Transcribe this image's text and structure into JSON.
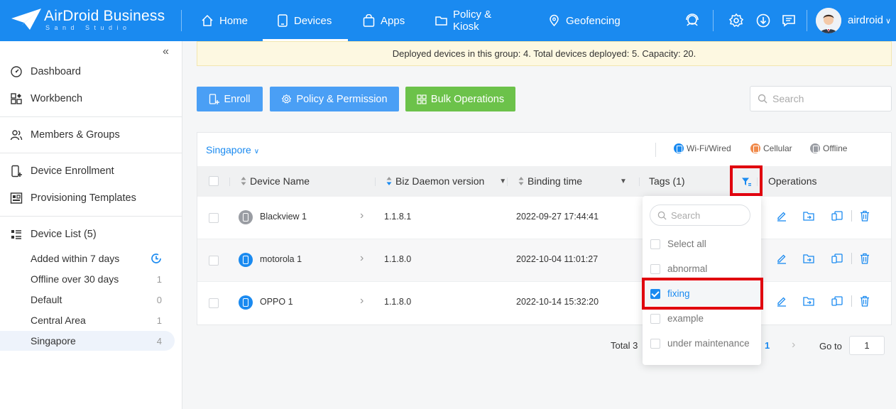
{
  "app": {
    "brand": "AirDroid Business",
    "sub_brand": "Sand Studio",
    "user": "airdroid",
    "nav": [
      {
        "label": "Home",
        "icon": "home-icon"
      },
      {
        "label": "Devices",
        "icon": "device-icon"
      },
      {
        "label": "Apps",
        "icon": "apps-bag-icon"
      },
      {
        "label": "Policy & Kiosk",
        "icon": "folder-icon"
      },
      {
        "label": "Geofencing",
        "icon": "map-pin-icon"
      }
    ],
    "active_nav": "Devices"
  },
  "sidebar": {
    "items": [
      {
        "label": "Dashboard",
        "icon": "dashboard-icon"
      },
      {
        "label": "Workbench",
        "icon": "workbench-icon"
      },
      {
        "label": "Members & Groups",
        "icon": "members-icon"
      },
      {
        "label": "Device Enrollment",
        "icon": "enroll-icon"
      },
      {
        "label": "Provisioning Templates",
        "icon": "template-icon"
      },
      {
        "label": "Device List (5)",
        "icon": "list-icon"
      }
    ],
    "groups": [
      {
        "label": "Added within 7 days",
        "count": ""
      },
      {
        "label": "Offline over 30 days",
        "count": "1"
      },
      {
        "label": "Default",
        "count": "0"
      },
      {
        "label": "Central Area",
        "count": "1"
      },
      {
        "label": "Singapore",
        "count": "4"
      }
    ],
    "active_group": "Singapore"
  },
  "main": {
    "notice": "Deployed devices in this group: 4. Total devices deployed: 5. Capacity: 20.",
    "buttons": {
      "enroll": "Enroll",
      "policy": "Policy & Permission",
      "bulk": "Bulk Operations"
    },
    "search_placeholder": "Search",
    "group_selector": "Singapore",
    "legend": [
      {
        "label": "Wi-Fi/Wired",
        "color": "#1a8af0"
      },
      {
        "label": "Cellular",
        "color": "#f08a4b"
      },
      {
        "label": "Offline",
        "color": "#9a9da3"
      }
    ],
    "columns": {
      "device_name": "Device Name",
      "biz_daemon": "Biz Daemon version",
      "binding_time": "Binding time",
      "tags": "Tags (1)",
      "operations": "Operations"
    },
    "rows": [
      {
        "name": "Blackview 1",
        "version": "1.1.8.1",
        "binding_time": "2022-09-27 17:44:41",
        "status_color": "#9a9da3"
      },
      {
        "name": "motorola 1",
        "version": "1.1.8.0",
        "binding_time": "2022-10-04 11:01:27",
        "status_color": "#1a8af0"
      },
      {
        "name": "OPPO 1",
        "version": "1.1.8.0",
        "binding_time": "2022-10-14 15:32:20",
        "status_color": "#1a8af0"
      }
    ],
    "pager": {
      "total": "Total 3",
      "current_page": "1",
      "goto_label": "Go to",
      "goto_value": "1"
    }
  },
  "tag_filter": {
    "search_placeholder": "Search",
    "options": [
      {
        "label": "Select all",
        "checked": false
      },
      {
        "label": "abnormal",
        "checked": false
      },
      {
        "label": "fixing",
        "checked": true
      },
      {
        "label": "example",
        "checked": false
      },
      {
        "label": "under maintenance",
        "checked": false
      }
    ]
  },
  "colors": {
    "primary": "#1a8af0",
    "green": "#6cc24a",
    "highlight": "#e0000e"
  }
}
